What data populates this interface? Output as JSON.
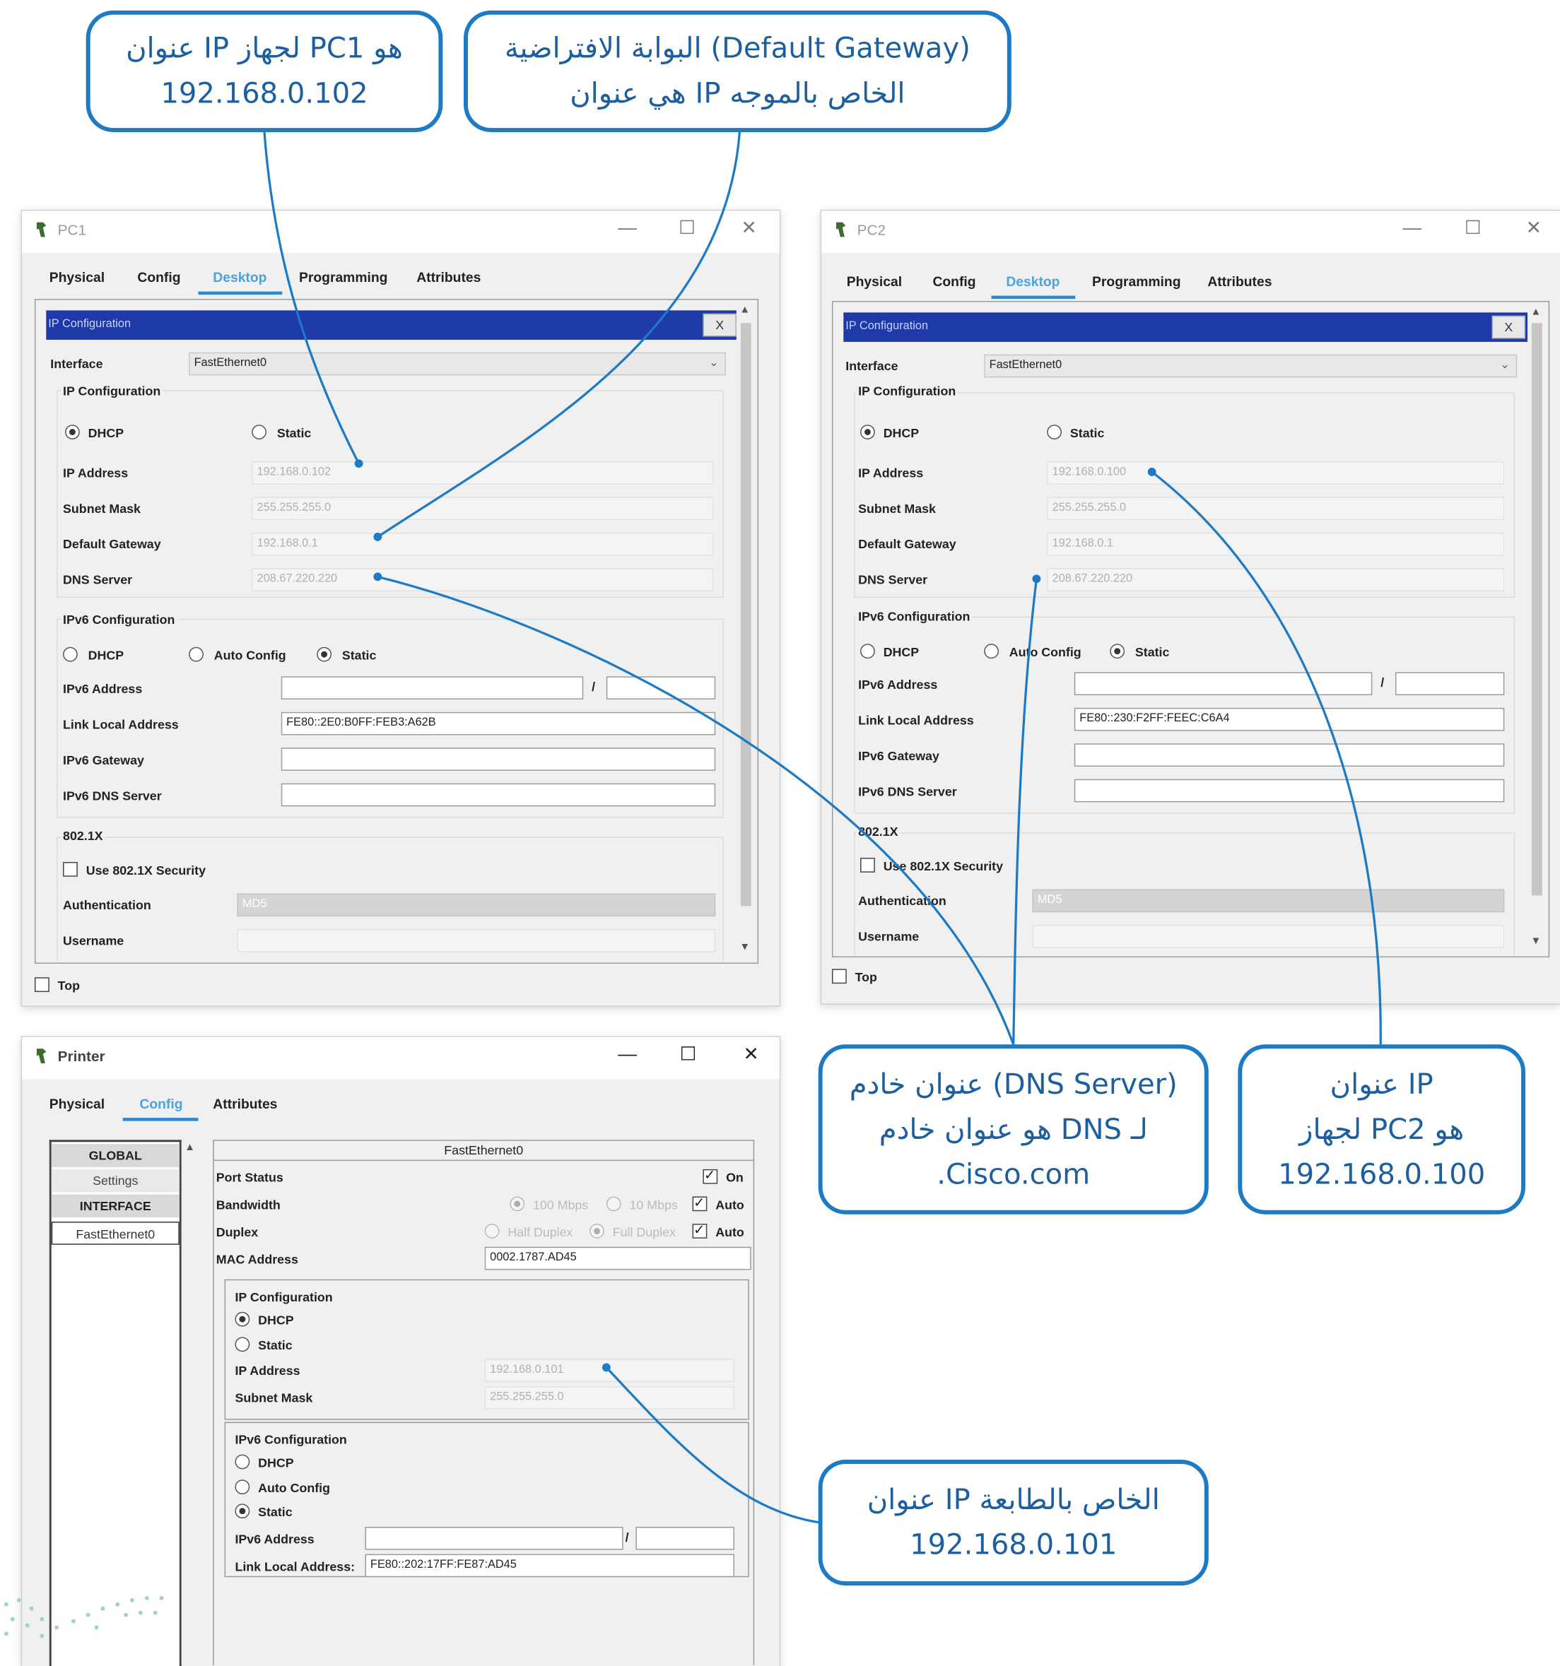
{
  "callouts": {
    "pc1_ip": {
      "line1": "عنوان IP لجهاز PC1 هو",
      "line2": "192.168.0.102"
    },
    "gateway": {
      "line1": "البوابة الافتراضية (Default Gateway)",
      "line2": "هي عنوان IP الخاص بالموجه"
    },
    "dns": {
      "line1": "عنوان خادم (DNS Server)",
      "line2": "هو عنوان خادم DNS لـ",
      "line3": ".Cisco.com"
    },
    "pc2_ip": {
      "line1": "عنوان IP",
      "line2": "لجهاز PC2 هو",
      "line3": "192.168.0.100"
    },
    "printer_ip": {
      "line1": "عنوان IP الخاص بالطابعة",
      "line2": "192.168.0.101"
    }
  },
  "pc1": {
    "title": "PC1",
    "tabs": [
      "Physical",
      "Config",
      "Desktop",
      "Programming",
      "Attributes"
    ],
    "panel_title": "IP Configuration",
    "close": "X",
    "interface_label": "Interface",
    "interface_value": "FastEthernet0",
    "ip_config_label": "IP Configuration",
    "dhcp": "DHCP",
    "static": "Static",
    "ip_label": "IP Address",
    "ip_value": "192.168.0.102",
    "mask_label": "Subnet Mask",
    "mask_value": "255.255.255.0",
    "gw_label": "Default Gateway",
    "gw_value": "192.168.0.1",
    "dns_label": "DNS Server",
    "dns_value": "208.67.220.220",
    "ipv6_config_label": "IPv6 Configuration",
    "ipv6_dhcp": "DHCP",
    "ipv6_auto": "Auto Config",
    "ipv6_static": "Static",
    "ipv6_addr_label": "IPv6 Address",
    "slash": "/",
    "link_local_label": "Link Local Address",
    "link_local_value": "FE80::2E0:B0FF:FEB3:A62B",
    "ipv6_gw_label": "IPv6 Gateway",
    "ipv6_dns_label": "IPv6 DNS Server",
    "dot1x_label": "802.1X",
    "use_dot1x": "Use 802.1X Security",
    "auth_label": "Authentication",
    "auth_value": "MD5",
    "username_label": "Username",
    "top_label": "Top"
  },
  "pc2": {
    "title": "PC2",
    "tabs": [
      "Physical",
      "Config",
      "Desktop",
      "Programming",
      "Attributes"
    ],
    "panel_title": "IP Configuration",
    "close": "X",
    "interface_label": "Interface",
    "interface_value": "FastEthernet0",
    "ip_config_label": "IP Configuration",
    "dhcp": "DHCP",
    "static": "Static",
    "ip_label": "IP Address",
    "ip_value": "192.168.0.100",
    "mask_label": "Subnet Mask",
    "mask_value": "255.255.255.0",
    "gw_label": "Default Gateway",
    "gw_value": "192.168.0.1",
    "dns_label": "DNS Server",
    "dns_value": "208.67.220.220",
    "ipv6_config_label": "IPv6 Configuration",
    "ipv6_dhcp": "DHCP",
    "ipv6_auto": "Auto Config",
    "ipv6_static": "Static",
    "ipv6_addr_label": "IPv6 Address",
    "slash": "/",
    "link_local_label": "Link Local Address",
    "link_local_value": "FE80::230:F2FF:FEEC:C6A4",
    "ipv6_gw_label": "IPv6 Gateway",
    "ipv6_dns_label": "IPv6 DNS Server",
    "dot1x_label": "802.1X",
    "use_dot1x": "Use 802.1X Security",
    "auth_label": "Authentication",
    "auth_value": "MD5",
    "username_label": "Username",
    "top_label": "Top"
  },
  "printer": {
    "title": "Printer",
    "tabs": [
      "Physical",
      "Config",
      "Attributes"
    ],
    "sidebar": {
      "global": "GLOBAL",
      "settings": "Settings",
      "interface": "INTERFACE",
      "fe0": "FastEthernet0"
    },
    "fe_header": "FastEthernet0",
    "port_status_label": "Port Status",
    "port_on": "On",
    "bandwidth_label": "Bandwidth",
    "bw_100": "100 Mbps",
    "bw_10": "10 Mbps",
    "auto": "Auto",
    "duplex_label": "Duplex",
    "half": "Half Duplex",
    "full": "Full Duplex",
    "mac_label": "MAC Address",
    "mac_value": "0002.1787.AD45",
    "ip_config_label": "IP Configuration",
    "dhcp": "DHCP",
    "static": "Static",
    "ip_label": "IP Address",
    "ip_value": "192.168.0.101",
    "mask_label": "Subnet Mask",
    "mask_value": "255.255.255.0",
    "ipv6_config_label": "IPv6 Configuration",
    "ipv6_dhcp": "DHCP",
    "ipv6_auto": "Auto Config",
    "ipv6_static": "Static",
    "ipv6_addr_label": "IPv6 Address",
    "slash": "/",
    "link_local_label": "Link Local Address:",
    "link_local_value": "FE80::202:17FF:FE87:AD45"
  },
  "window_controls": {
    "minimize": "—",
    "maximize": "☐",
    "close": "✕"
  },
  "colors": {
    "callout_border": "#1d7ac4",
    "callout_text": "#1d5f9e",
    "panel_header": "#1e3aa8",
    "active_tab": "#4aa3df"
  }
}
